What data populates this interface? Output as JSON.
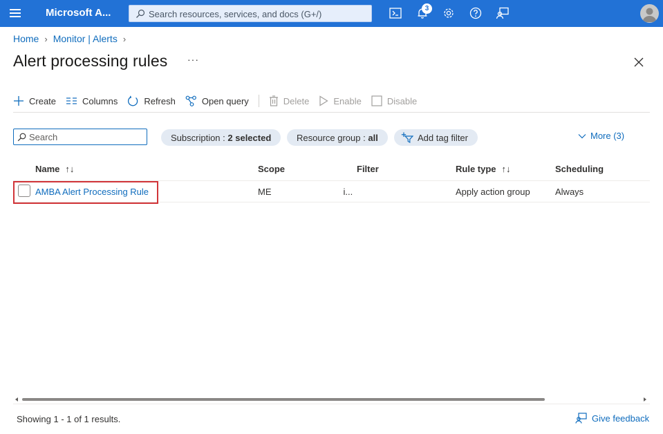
{
  "topbar": {
    "brand": "Microsoft A...",
    "search_placeholder": "Search resources, services, and docs (G+/)",
    "notification_count": "3",
    "icons": [
      "menu-icon",
      "cloud-shell-icon",
      "notifications-icon",
      "settings-icon",
      "help-icon",
      "feedback-icon"
    ]
  },
  "breadcrumb": {
    "home": "Home",
    "parent": "Monitor | Alerts"
  },
  "page": {
    "title": "Alert processing rules",
    "more": "···"
  },
  "toolbar": {
    "create": "Create",
    "columns": "Columns",
    "refresh": "Refresh",
    "open_query": "Open query",
    "delete": "Delete",
    "enable": "Enable",
    "disable": "Disable"
  },
  "filters": {
    "search_placeholder": "Search",
    "subscription_label": "Subscription : ",
    "subscription_value": "2 selected",
    "resource_group_label": "Resource group : ",
    "resource_group_value": "all",
    "add_tag_filter": "Add tag filter",
    "more": "More (3)"
  },
  "table": {
    "columns": {
      "name": "Name",
      "scope": "Scope",
      "filter": "Filter",
      "rule_type": "Rule type",
      "scheduling": "Scheduling"
    },
    "sort_glyph": "↑↓",
    "rows": [
      {
        "name": "AMBA Alert Processing Rule",
        "scope": "ME",
        "scope_tail": "i...",
        "filter": "",
        "rule_type": "Apply action group",
        "scheduling": "Always"
      }
    ]
  },
  "footer": {
    "showing": "Showing 1 - 1 of 1 results.",
    "feedback": "Give feedback"
  },
  "colors": {
    "topbar": "#2272d6",
    "link": "#0f6cbd",
    "highlight": "#d13438"
  }
}
